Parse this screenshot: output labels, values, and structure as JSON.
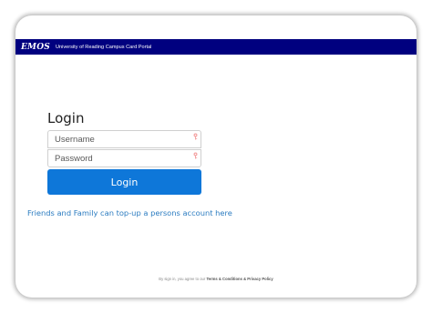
{
  "header": {
    "logo": "EMOS",
    "portal_title": "University of Reading Campus Card Portal",
    "bar_color": "#00007f"
  },
  "login": {
    "heading": "Login",
    "username_placeholder": "Username",
    "password_placeholder": "Password",
    "field_icon": "key-icon",
    "button_label": "Login",
    "button_color": "#0e77d9"
  },
  "family_link": "Friends and Family can top-up a persons account here",
  "footer": {
    "prefix": "By sign in, you agree to our",
    "terms": "Terms & Conditions",
    "and": "&",
    "privacy": "Privacy Policy"
  }
}
